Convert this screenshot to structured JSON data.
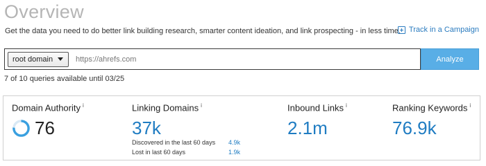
{
  "header": {
    "title": "Overview",
    "subtitle": "Get the data you need to do better link building research, smarter content ideation, and link prospecting - in less time.",
    "track_link": "Track in a Campaign"
  },
  "search": {
    "scope_selected": "root domain",
    "url_placeholder": "https://ahrefs.com",
    "analyze_label": "Analyze"
  },
  "quota": {
    "text": "7 of 10 queries available until 03/25"
  },
  "metrics": {
    "domain_authority": {
      "label": "Domain Authority",
      "info": "i",
      "value": "76",
      "ring_fraction": 0.76
    },
    "linking_domains": {
      "label": "Linking Domains",
      "info": "i",
      "value": "37k",
      "discovered_label": "Discovered in the last 60 days",
      "discovered_value": "4.9k",
      "lost_label": "Lost in last 60 days",
      "lost_value": "1.9k"
    },
    "inbound_links": {
      "label": "Inbound Links",
      "info": "i",
      "value": "2.1m"
    },
    "ranking_keywords": {
      "label": "Ranking Keywords",
      "info": "i",
      "value": "76.9k"
    }
  },
  "colors": {
    "accent": "#1f7cc2",
    "analyze_button": "#59aee6",
    "ring": "#3aa0e0",
    "ring_track": "#d9e9f5"
  },
  "icons": {
    "track_icon": "plus-square-icon",
    "select_caret": "caret-down-icon",
    "da_ring": "progress-ring-icon"
  }
}
